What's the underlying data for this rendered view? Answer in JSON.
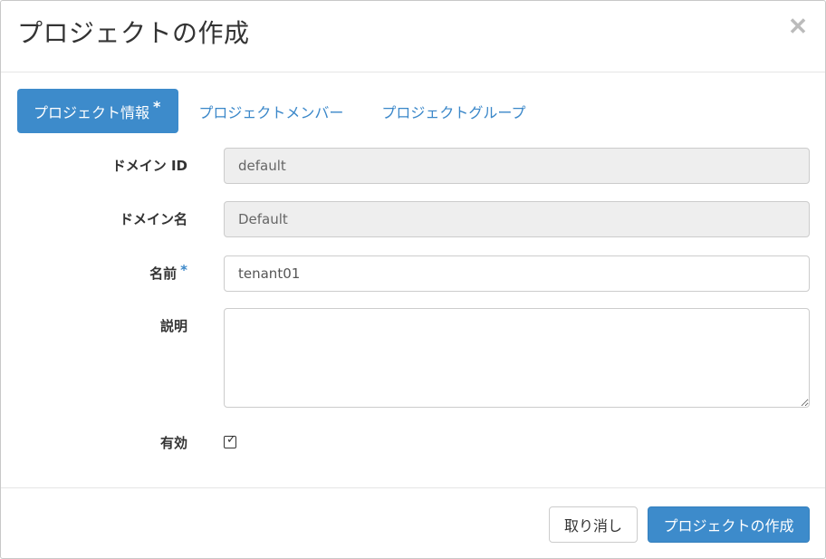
{
  "modal": {
    "title": "プロジェクトの作成",
    "close_glyph": "✕"
  },
  "tabs": [
    {
      "label": "プロジェクト情報",
      "required_mark": "*",
      "active": true
    },
    {
      "label": "プロジェクトメンバー",
      "active": false
    },
    {
      "label": "プロジェクトグループ",
      "active": false
    }
  ],
  "form": {
    "domain_id": {
      "label": "ドメイン ID",
      "value": "default"
    },
    "domain_name": {
      "label": "ドメイン名",
      "value": "Default"
    },
    "name": {
      "label": "名前",
      "required_mark": "*",
      "value": "tenant01"
    },
    "description": {
      "label": "説明",
      "value": ""
    },
    "enabled": {
      "label": "有効",
      "checked": true,
      "check_glyph": "✓"
    }
  },
  "footer": {
    "cancel_label": "取り消し",
    "submit_label": "プロジェクトの作成"
  },
  "colors": {
    "primary": "#3d8bcb",
    "link": "#3a87c9",
    "readonly_bg": "#eeeeee"
  }
}
